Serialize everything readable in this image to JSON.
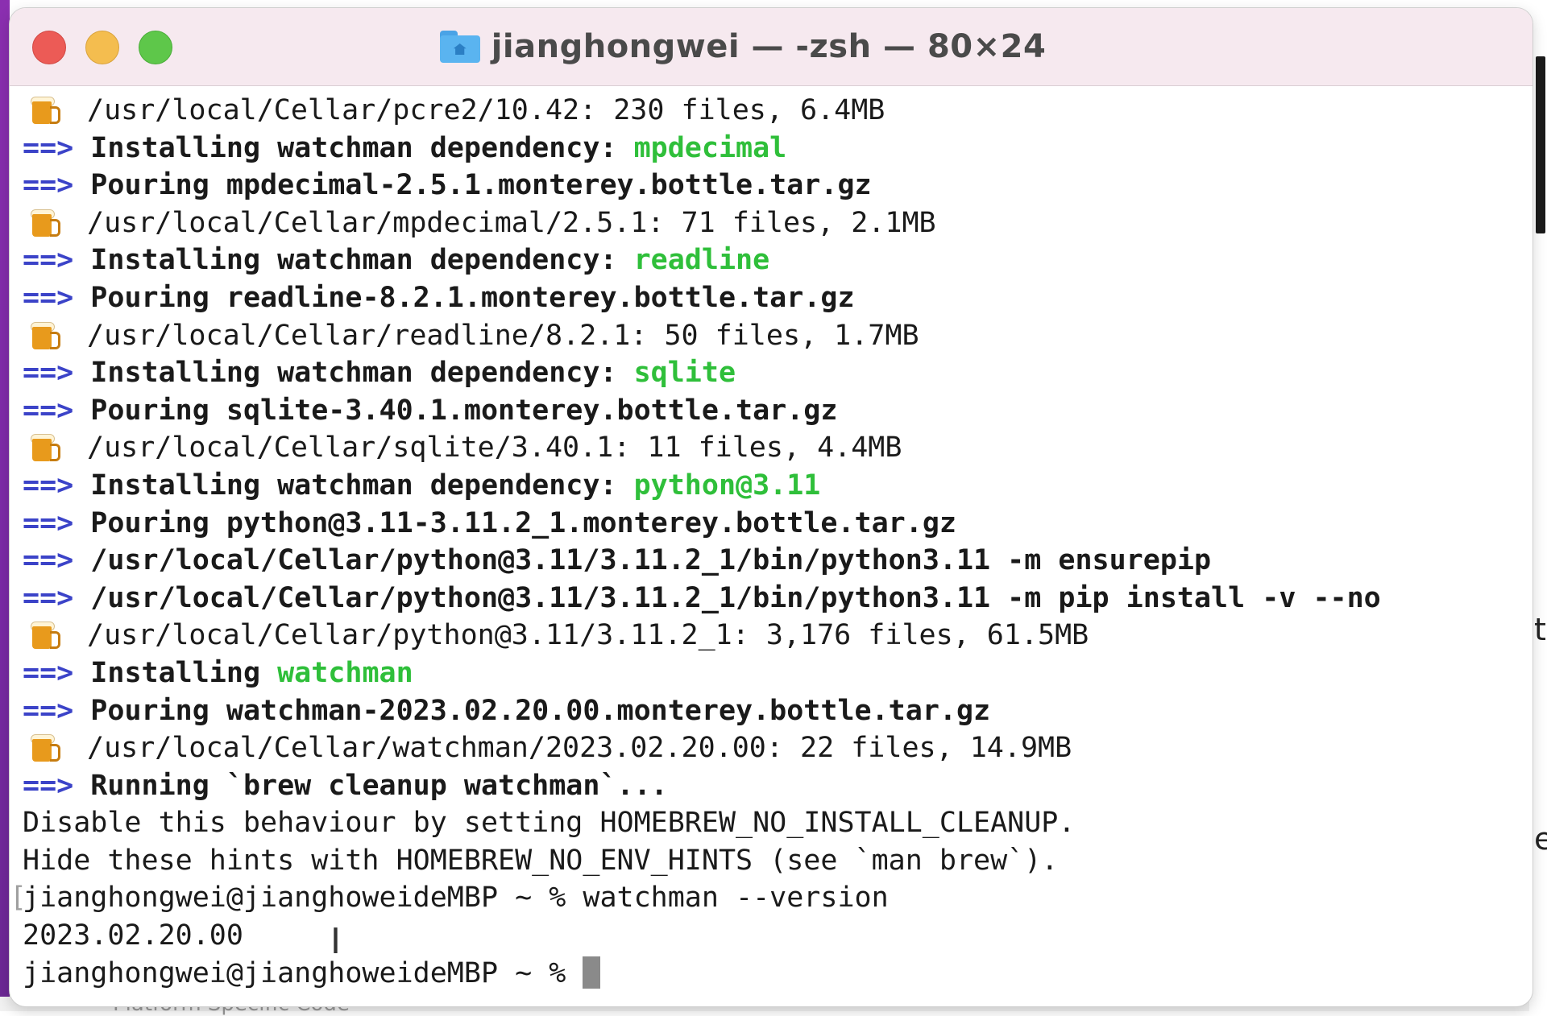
{
  "window": {
    "title": "jianghongwei — -zsh — 80×24"
  },
  "background": {
    "bottom_text": "Platform Specific Code",
    "right_glyphs": [
      "t",
      "e"
    ]
  },
  "terminal": {
    "lines": [
      {
        "type": "beer",
        "text": "/usr/local/Cellar/pcre2/10.42: 230 files, 6.4MB"
      },
      {
        "type": "arrow",
        "text": "Installing watchman dependency: ",
        "highlight": "mpdecimal"
      },
      {
        "type": "arrow",
        "text": "Pouring mpdecimal-2.5.1.monterey.bottle.tar.gz"
      },
      {
        "type": "beer",
        "text": "/usr/local/Cellar/mpdecimal/2.5.1: 71 files, 2.1MB"
      },
      {
        "type": "arrow",
        "text": "Installing watchman dependency: ",
        "highlight": "readline"
      },
      {
        "type": "arrow",
        "text": "Pouring readline-8.2.1.monterey.bottle.tar.gz"
      },
      {
        "type": "beer",
        "text": "/usr/local/Cellar/readline/8.2.1: 50 files, 1.7MB"
      },
      {
        "type": "arrow",
        "text": "Installing watchman dependency: ",
        "highlight": "sqlite"
      },
      {
        "type": "arrow",
        "text": "Pouring sqlite-3.40.1.monterey.bottle.tar.gz"
      },
      {
        "type": "beer",
        "text": "/usr/local/Cellar/sqlite/3.40.1: 11 files, 4.4MB"
      },
      {
        "type": "arrow",
        "text": "Installing watchman dependency: ",
        "highlight": "python@3.11"
      },
      {
        "type": "arrow",
        "text": "Pouring python@3.11-3.11.2_1.monterey.bottle.tar.gz"
      },
      {
        "type": "arrow",
        "text": "/usr/local/Cellar/python@3.11/3.11.2_1/bin/python3.11 -m ensurepip"
      },
      {
        "type": "arrow",
        "text": "/usr/local/Cellar/python@3.11/3.11.2_1/bin/python3.11 -m pip install -v --no"
      },
      {
        "type": "beer",
        "text": "/usr/local/Cellar/python@3.11/3.11.2_1: 3,176 files, 61.5MB"
      },
      {
        "type": "arrow",
        "text": "Installing ",
        "highlight": "watchman"
      },
      {
        "type": "arrow",
        "text": "Pouring watchman-2023.02.20.00.monterey.bottle.tar.gz"
      },
      {
        "type": "beer",
        "text": "/usr/local/Cellar/watchman/2023.02.20.00: 22 files, 14.9MB"
      },
      {
        "type": "arrow",
        "text": "Running `brew cleanup watchman`..."
      },
      {
        "type": "plain",
        "text": "Disable this behaviour by setting HOMEBREW_NO_INSTALL_CLEANUP."
      },
      {
        "type": "plain",
        "text": "Hide these hints with HOMEBREW_NO_ENV_HINTS (see `man brew`)."
      },
      {
        "type": "prompt",
        "text": "jianghongwei@jianghoweideMBP ~ % watchman --version"
      },
      {
        "type": "plain",
        "text": "2023.02.20.00"
      },
      {
        "type": "prompt-active",
        "text": "jianghongwei@jianghoweideMBP ~ % "
      }
    ],
    "arrow_glyph": "==>"
  }
}
